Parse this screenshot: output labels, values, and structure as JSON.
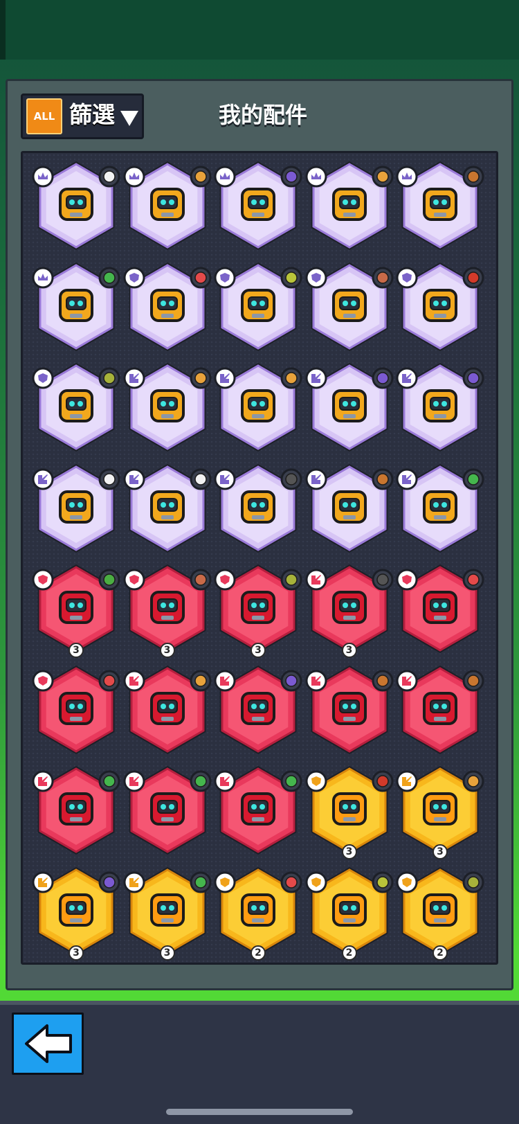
{
  "header": {
    "filter_all_label": "ALL",
    "filter_label": "篩選",
    "title": "我的配件"
  },
  "colors": {
    "purple": "#c9b7f2",
    "red": "#e8395b",
    "yellow": "#f7b71b"
  },
  "accessories": [
    {
      "rarity": "purple",
      "role": "crown",
      "item": "ball",
      "robot": "robot-face"
    },
    {
      "rarity": "purple",
      "role": "crown",
      "item": "croissant",
      "robot": "target-module"
    },
    {
      "rarity": "purple",
      "role": "crown",
      "item": "cone",
      "robot": "robot-face"
    },
    {
      "rarity": "purple",
      "role": "crown",
      "item": "croissant",
      "robot": "camera-module"
    },
    {
      "rarity": "purple",
      "role": "crown",
      "item": "bear",
      "robot": "wing-module"
    },
    {
      "rarity": "purple",
      "role": "crown",
      "item": "bottle",
      "robot": "hex-core"
    },
    {
      "rarity": "purple",
      "role": "shield",
      "item": "rocket",
      "robot": "shield-module"
    },
    {
      "rarity": "purple",
      "role": "shield",
      "item": "target",
      "robot": "gate-module"
    },
    {
      "rarity": "purple",
      "role": "shield",
      "item": "brick",
      "robot": "monitor-module"
    },
    {
      "rarity": "purple",
      "role": "shield",
      "item": "melon",
      "robot": "capsule-module"
    },
    {
      "rarity": "purple",
      "role": "shield",
      "item": "virus",
      "robot": "robot-face"
    },
    {
      "rarity": "purple",
      "role": "attack",
      "item": "croissant",
      "robot": "hex-core"
    },
    {
      "rarity": "purple",
      "role": "attack",
      "item": "croissant",
      "robot": "hex-core"
    },
    {
      "rarity": "purple",
      "role": "attack",
      "item": "cone",
      "robot": "box-module"
    },
    {
      "rarity": "purple",
      "role": "attack",
      "item": "cone",
      "robot": "box-module"
    },
    {
      "rarity": "purple",
      "role": "attack",
      "item": "ball",
      "robot": "visor-module"
    },
    {
      "rarity": "purple",
      "role": "attack",
      "item": "ball",
      "robot": "visor-module"
    },
    {
      "rarity": "purple",
      "role": "attack",
      "item": "toaster",
      "robot": "cube-module"
    },
    {
      "rarity": "purple",
      "role": "attack",
      "item": "bear",
      "robot": "wing-module"
    },
    {
      "rarity": "purple",
      "role": "attack",
      "item": "bottle",
      "robot": "triangle-module"
    },
    {
      "rarity": "red",
      "role": "shield",
      "item": "watermelon",
      "robot": "pack-module",
      "level": "3"
    },
    {
      "rarity": "red",
      "role": "shield",
      "item": "brick",
      "robot": "robot-face",
      "level": "3"
    },
    {
      "rarity": "red",
      "role": "shield",
      "item": "virus",
      "robot": "spider-module",
      "level": "3"
    },
    {
      "rarity": "red",
      "role": "attack",
      "item": "toaster",
      "robot": "target-module",
      "level": "3"
    },
    {
      "rarity": "red",
      "role": "shield",
      "item": "rocket",
      "robot": "shield-module"
    },
    {
      "rarity": "red",
      "role": "shield",
      "item": "rocket",
      "robot": "shield-module"
    },
    {
      "rarity": "red",
      "role": "attack",
      "item": "croissant",
      "robot": "tri-core"
    },
    {
      "rarity": "red",
      "role": "attack",
      "item": "cone",
      "robot": "box-module"
    },
    {
      "rarity": "red",
      "role": "attack",
      "item": "bear",
      "robot": "wing-module"
    },
    {
      "rarity": "red",
      "role": "attack",
      "item": "bear",
      "robot": "wing-module"
    },
    {
      "rarity": "red",
      "role": "attack",
      "item": "bottle",
      "robot": "hex-core"
    },
    {
      "rarity": "red",
      "role": "attack",
      "item": "bottle",
      "robot": "hex-core"
    },
    {
      "rarity": "red",
      "role": "attack",
      "item": "bottle",
      "robot": "hex-core"
    },
    {
      "rarity": "yellow",
      "role": "shield",
      "item": "melon",
      "robot": "capsule-module",
      "level": "3"
    },
    {
      "rarity": "yellow",
      "role": "attack",
      "item": "croissant",
      "robot": "turret-module",
      "level": "3"
    },
    {
      "rarity": "yellow",
      "role": "attack",
      "item": "cone",
      "robot": "monitor-module",
      "level": "3"
    },
    {
      "rarity": "yellow",
      "role": "attack",
      "item": "bottle",
      "robot": "triangle-module",
      "level": "3"
    },
    {
      "rarity": "yellow",
      "role": "shield",
      "item": "rocket",
      "robot": "wing-module",
      "level": "2"
    },
    {
      "rarity": "yellow",
      "role": "shield",
      "item": "target",
      "robot": "gate-module",
      "level": "2"
    },
    {
      "rarity": "yellow",
      "role": "shield",
      "item": "virus",
      "robot": "robot-face",
      "level": "2"
    }
  ],
  "back_button": {
    "icon": "arrow-left-icon"
  }
}
